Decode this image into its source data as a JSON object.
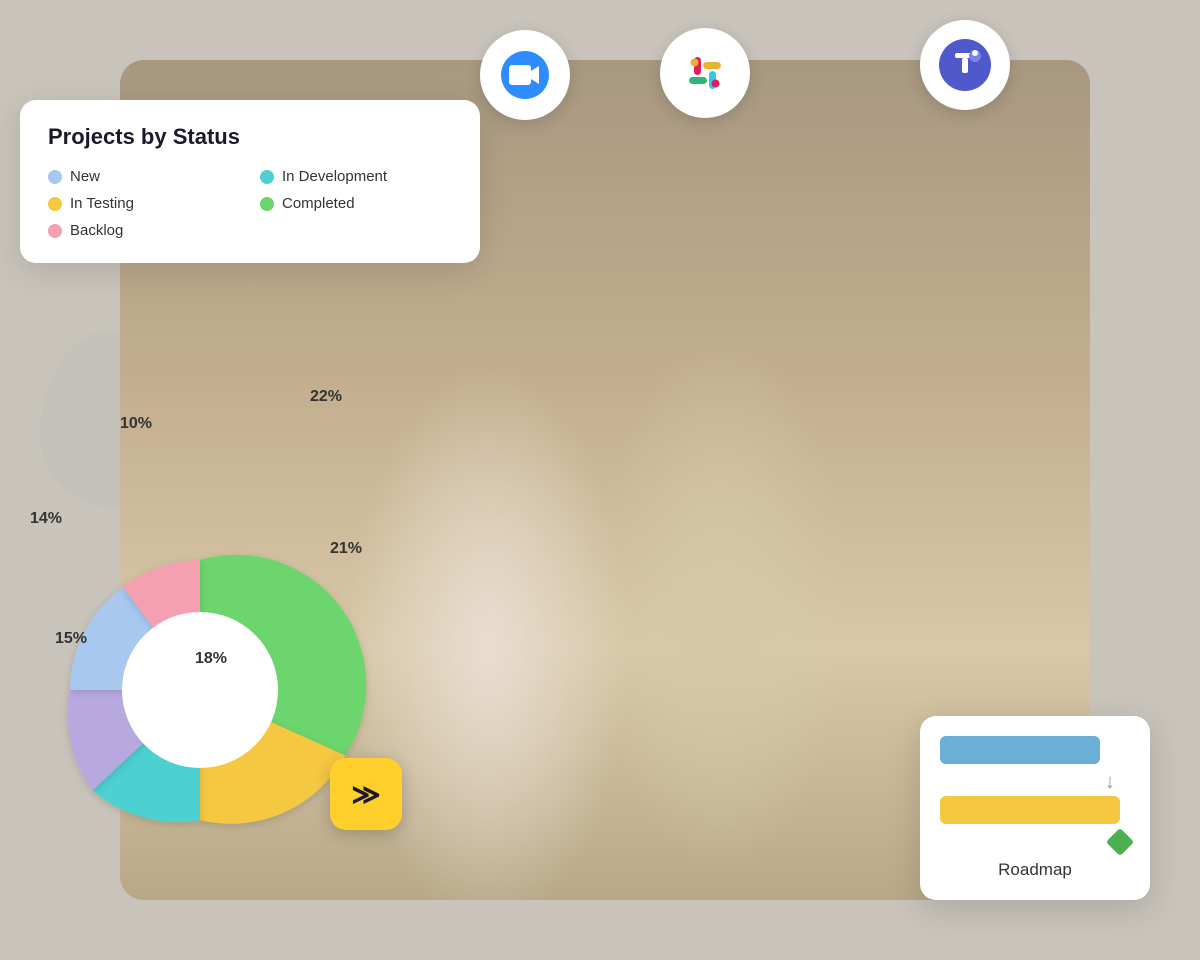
{
  "title": "Projects by Status",
  "legend": {
    "items": [
      {
        "label": "New",
        "color": "#a8c8f0"
      },
      {
        "label": "In Development",
        "color": "#4dd0d0"
      },
      {
        "label": "In Testing",
        "color": "#f5c842"
      },
      {
        "label": "Completed",
        "color": "#6dd56d"
      },
      {
        "label": "Backlog",
        "color": "#f4a0b0"
      }
    ]
  },
  "chart": {
    "segments": [
      {
        "label": "22%",
        "color": "#6dd56d",
        "value": 22
      },
      {
        "label": "21%",
        "color": "#f5c842",
        "value": 21
      },
      {
        "label": "18%",
        "color": "#4dd0d0",
        "value": 18
      },
      {
        "label": "15%",
        "color": "#b8a8e0",
        "value": 15
      },
      {
        "label": "14%",
        "color": "#a8c8f0",
        "value": 14
      },
      {
        "label": "10%",
        "color": "#f4a0b0",
        "value": 10
      }
    ]
  },
  "roadmap": {
    "label": "Roadmap"
  },
  "integrations": [
    {
      "name": "Zoom",
      "icon": "zoom-icon"
    },
    {
      "name": "Slack",
      "icon": "slack-icon"
    },
    {
      "name": "Microsoft Teams",
      "icon": "teams-icon"
    }
  ]
}
